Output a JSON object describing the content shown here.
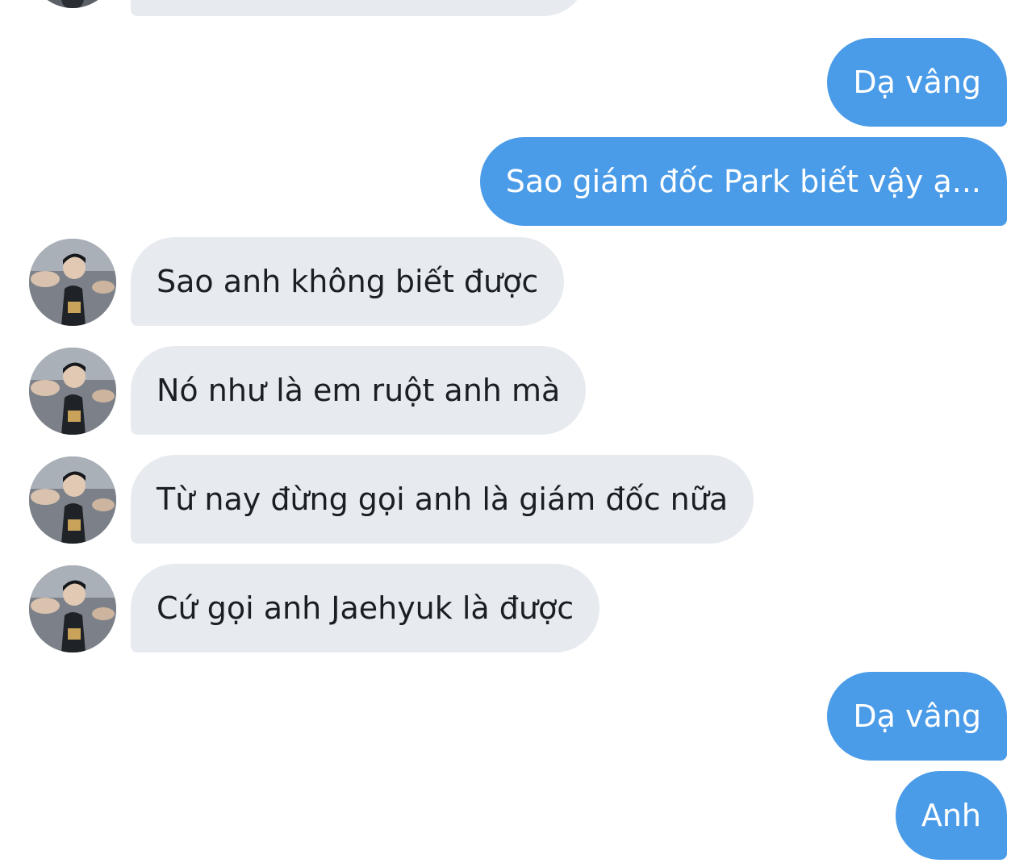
{
  "messages": [
    {
      "side": "out",
      "text": "Dạ vâng"
    },
    {
      "side": "out",
      "text": "Sao giám đốc Park biết vậy ạ..."
    },
    {
      "side": "in",
      "text": "Sao anh không biết được"
    },
    {
      "side": "in",
      "text": "Nó như là em ruột anh mà"
    },
    {
      "side": "in",
      "text": "Từ nay đừng gọi anh là giám đốc nữa"
    },
    {
      "side": "in",
      "text": "Cứ gọi anh Jaehyuk là được"
    },
    {
      "side": "out",
      "text": "Dạ vâng"
    },
    {
      "side": "out",
      "text": "Anh"
    }
  ],
  "colors": {
    "outgoing_bubble": "#4a9be8",
    "incoming_bubble": "#e7ebf0",
    "background": "#ffffff"
  },
  "icons": {
    "contact_avatar": "profile-photo-avatar"
  }
}
